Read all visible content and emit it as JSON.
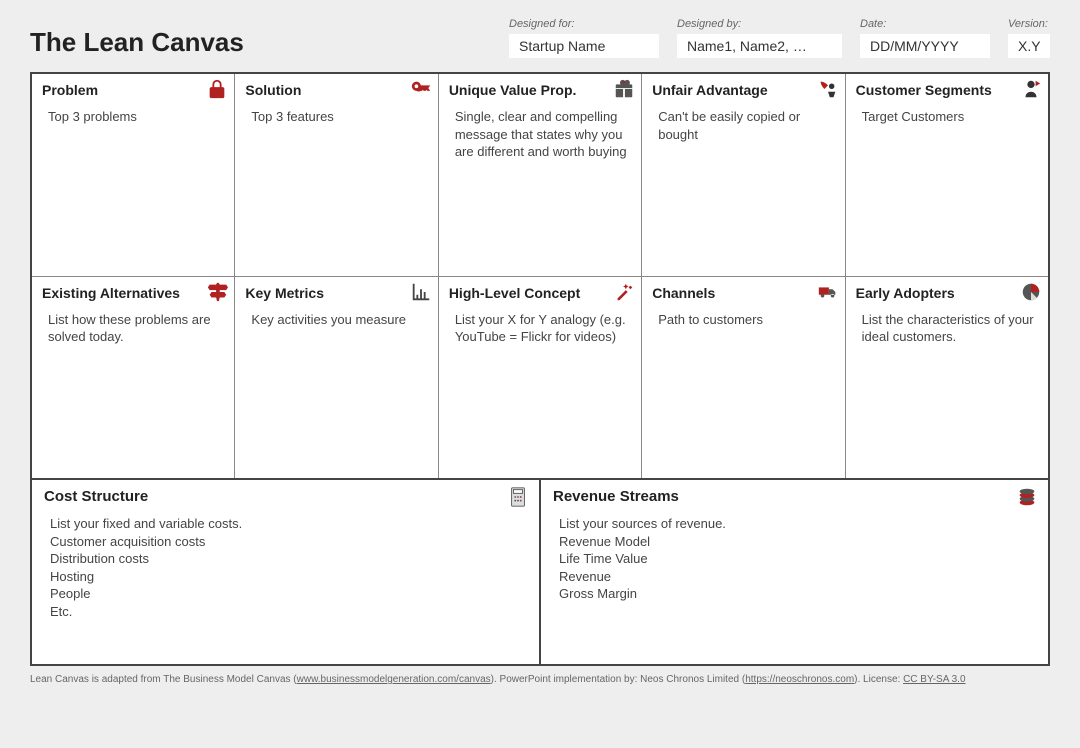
{
  "title": "The Lean Canvas",
  "meta": {
    "designed_for_label": "Designed for:",
    "designed_for_value": "Startup Name",
    "designed_by_label": "Designed by:",
    "designed_by_value": "Name1, Name2, …",
    "date_label": "Date:",
    "date_value": "DD/MM/YYYY",
    "version_label": "Version:",
    "version_value": "X.Y"
  },
  "cells": {
    "problem": {
      "title": "Problem",
      "body": "Top 3 problems"
    },
    "alternatives": {
      "title": "Existing Alternatives",
      "body": "List how these problems are solved today."
    },
    "solution": {
      "title": "Solution",
      "body": "Top 3 features"
    },
    "metrics": {
      "title": "Key Metrics",
      "body": "Key activities you measure"
    },
    "uvp": {
      "title": "Unique Value Prop.",
      "body": "Single, clear and compelling message that states why you are different and worth buying"
    },
    "concept": {
      "title": "High-Level Concept",
      "body": "List your X for Y analogy (e.g. YouTube = Flickr for videos)"
    },
    "advantage": {
      "title": "Unfair Advantage",
      "body": "Can't be easily copied or bought"
    },
    "channels": {
      "title": "Channels",
      "body": "Path to customers"
    },
    "segments": {
      "title": "Customer Segments",
      "body": "Target Customers"
    },
    "adopters": {
      "title": "Early Adopters",
      "body": "List the characteristics of your ideal customers."
    },
    "cost": {
      "title": "Cost Structure",
      "body": "List your fixed and variable costs.\nCustomer acquisition costs\nDistribution costs\nHosting\nPeople\nEtc."
    },
    "revenue": {
      "title": "Revenue Streams",
      "body": "List your sources of revenue.\nRevenue Model\nLife Time Value\nRevenue\nGross Margin"
    }
  },
  "footer": {
    "t1": "Lean Canvas is adapted from The Business Model Canvas (",
    "l1": "www.businessmodelgeneration.com/canvas",
    "t2": "). PowerPoint implementation by: Neos Chronos Limited (",
    "l2": "https://neoschronos.com",
    "t3": "). License: ",
    "l3": "CC BY-SA 3.0"
  }
}
